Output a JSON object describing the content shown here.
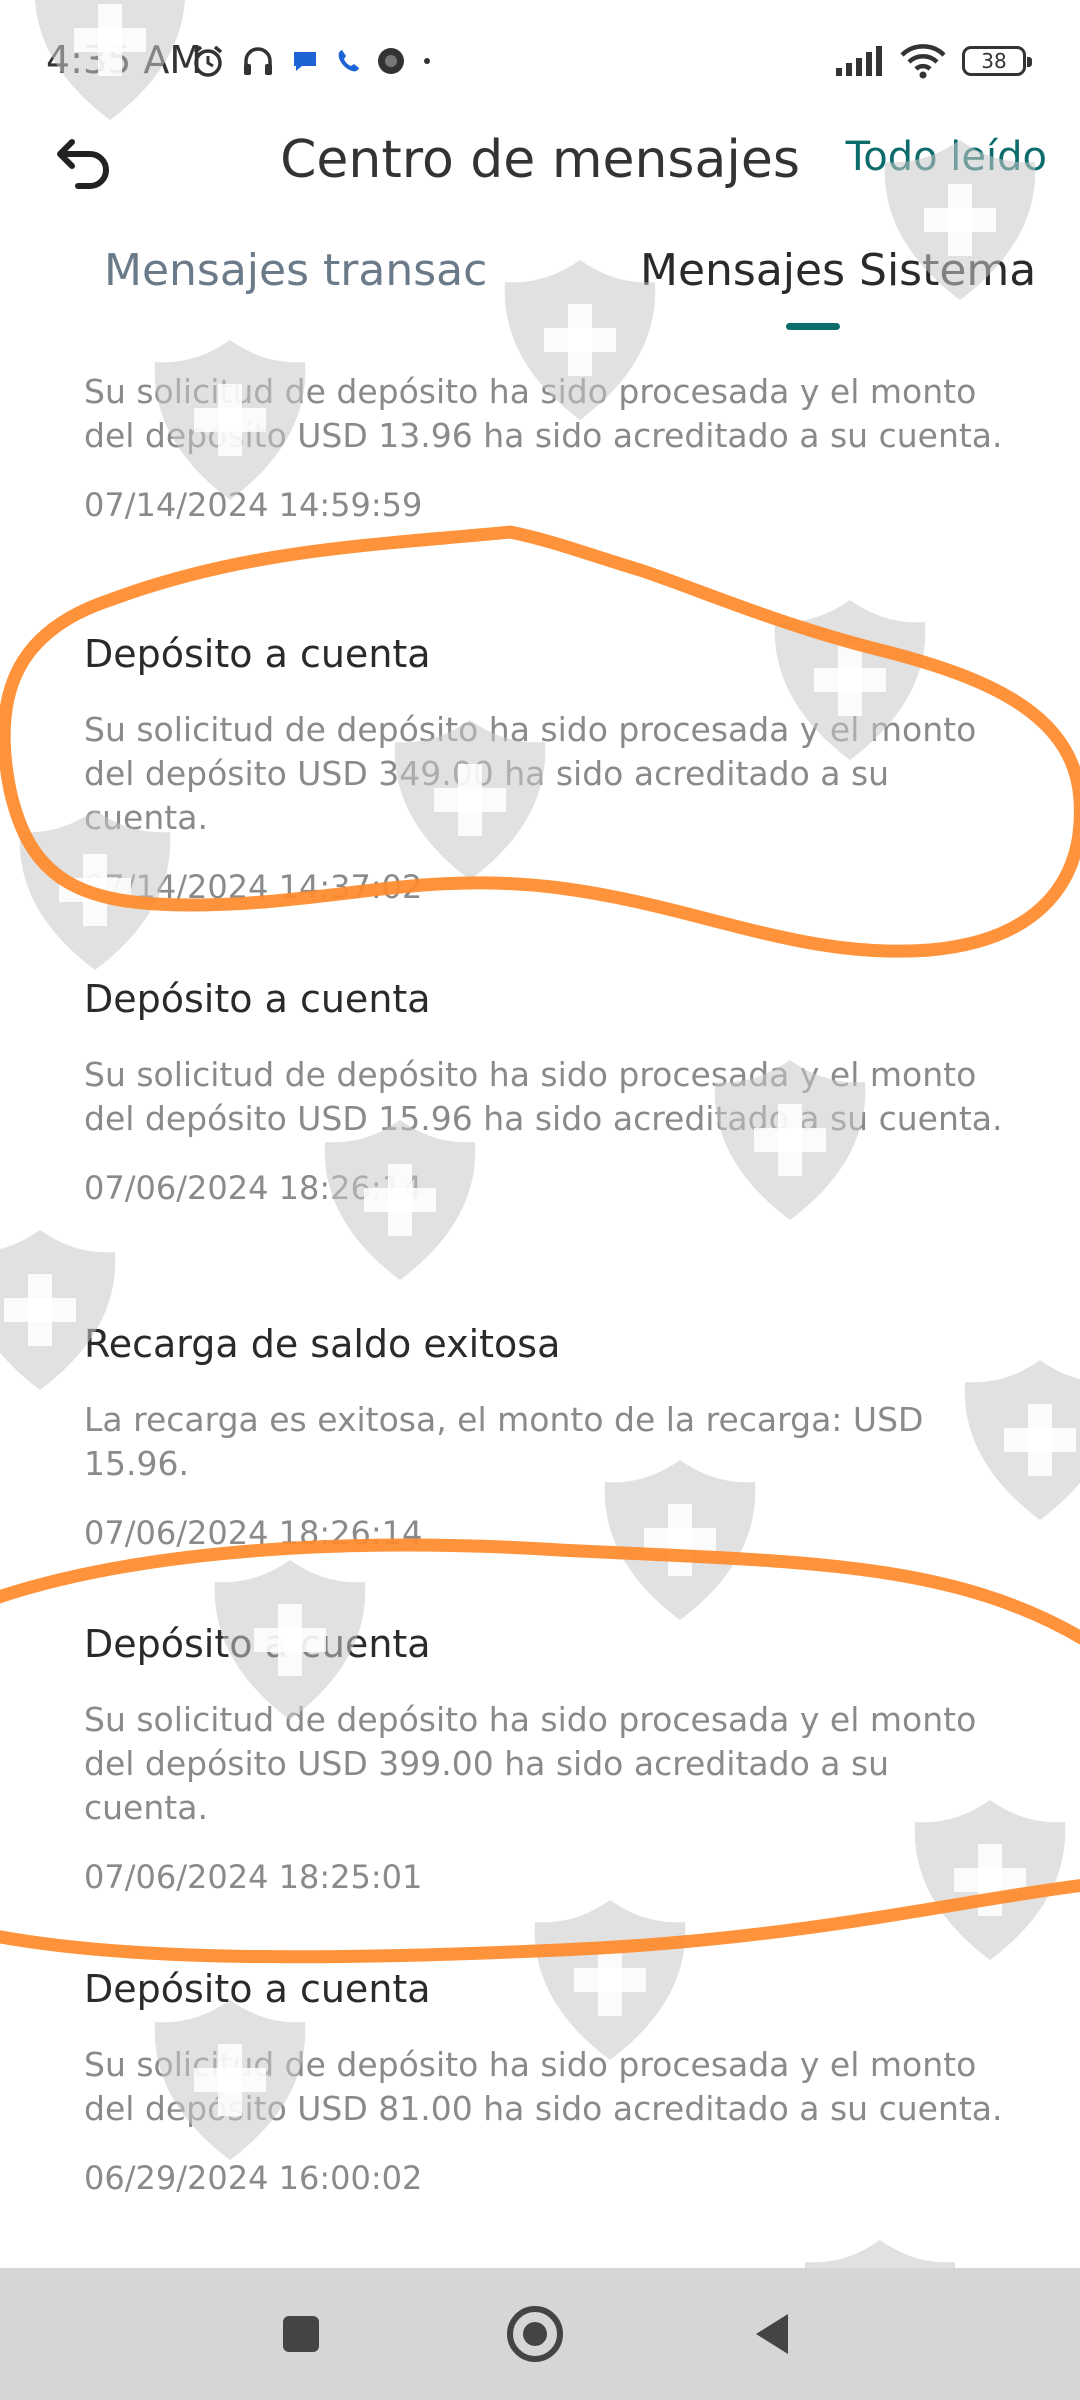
{
  "status_bar": {
    "time": "4:35 AM",
    "battery_level": "38",
    "icons_left": [
      "alarm-icon",
      "headset-icon",
      "chat-icon",
      "phone-icon",
      "app-icon",
      "dot-icon"
    ],
    "icons_right": [
      "signal-icon",
      "wifi-icon",
      "battery-icon"
    ]
  },
  "header": {
    "title": "Centro de mensajes",
    "mark_all_read": "Todo leído",
    "back_icon": "back-arrow-icon"
  },
  "tabs": [
    {
      "label": "Mensajes transac",
      "active": false
    },
    {
      "label": "Mensajes Sistema",
      "active": true
    }
  ],
  "messages": [
    {
      "title": "",
      "body": "Su solicitud de depósito ha sido procesada y el monto del depósito USD 13.96 ha sido acreditado a su cuenta.",
      "date": "07/14/2024 14:59:59"
    },
    {
      "title": "Depósito a cuenta",
      "body": "Su solicitud de depósito ha sido procesada y el monto del depósito USD 349.00 ha sido acreditado a su cuenta.",
      "date": "07/14/2024 14:37:02"
    },
    {
      "title": "Depósito a cuenta",
      "body": "Su solicitud de depósito ha sido procesada y el monto del depósito USD 15.96 ha sido acreditado a su cuenta.",
      "date": "07/06/2024 18:26:14"
    },
    {
      "title": "Recarga de saldo exitosa",
      "body": "La recarga es exitosa, el monto de la recarga: USD 15.96.",
      "date": "07/06/2024 18:26:14"
    },
    {
      "title": "Depósito a cuenta",
      "body": "Su solicitud de depósito ha sido procesada y el monto del depósito USD 399.00 ha sido acreditado a su cuenta.",
      "date": "07/06/2024 18:25:01"
    },
    {
      "title": "Depósito a cuenta",
      "body": "Su solicitud de depósito ha sido procesada y el monto del depósito USD 81.00 ha sido acreditado a su cuenta.",
      "date": "06/29/2024 16:00:02"
    }
  ],
  "nav_bar": {
    "buttons": [
      "recents-square-icon",
      "home-circle-icon",
      "back-triangle-icon"
    ]
  },
  "colors": {
    "accent": "#0c6b6b",
    "annotation": "#ff8a2a",
    "watermark": "#c8c8c8"
  }
}
